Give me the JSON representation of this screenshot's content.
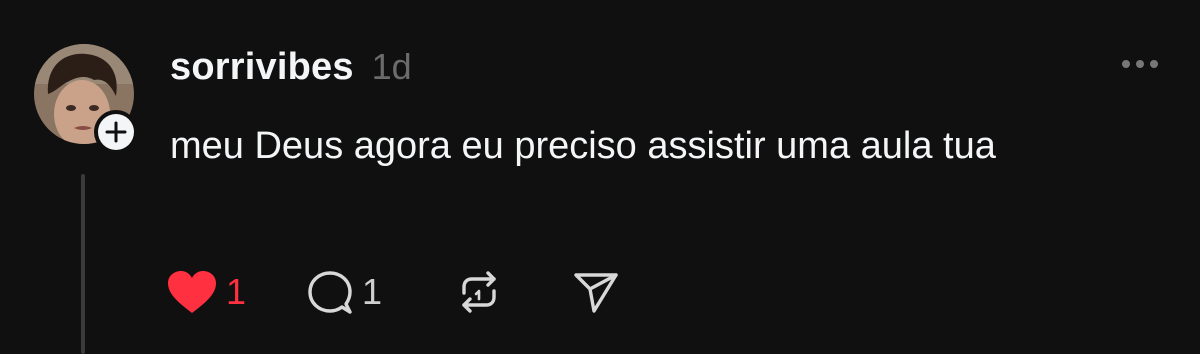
{
  "post": {
    "username": "sorrivibes",
    "time": "1d",
    "text": "meu Deus agora eu preciso assistir uma aula tua"
  },
  "actions": {
    "likes": "1",
    "replies": "1"
  },
  "icons": {
    "follow": "plus-icon",
    "like": "heart-icon",
    "reply": "comment-bubble-icon",
    "repost": "repost-icon",
    "share": "send-icon",
    "more": "more-options-icon"
  },
  "colors": {
    "background": "#101010",
    "text": "#f3f5f7",
    "muted": "#6b6b6b",
    "like": "#ff3040"
  }
}
